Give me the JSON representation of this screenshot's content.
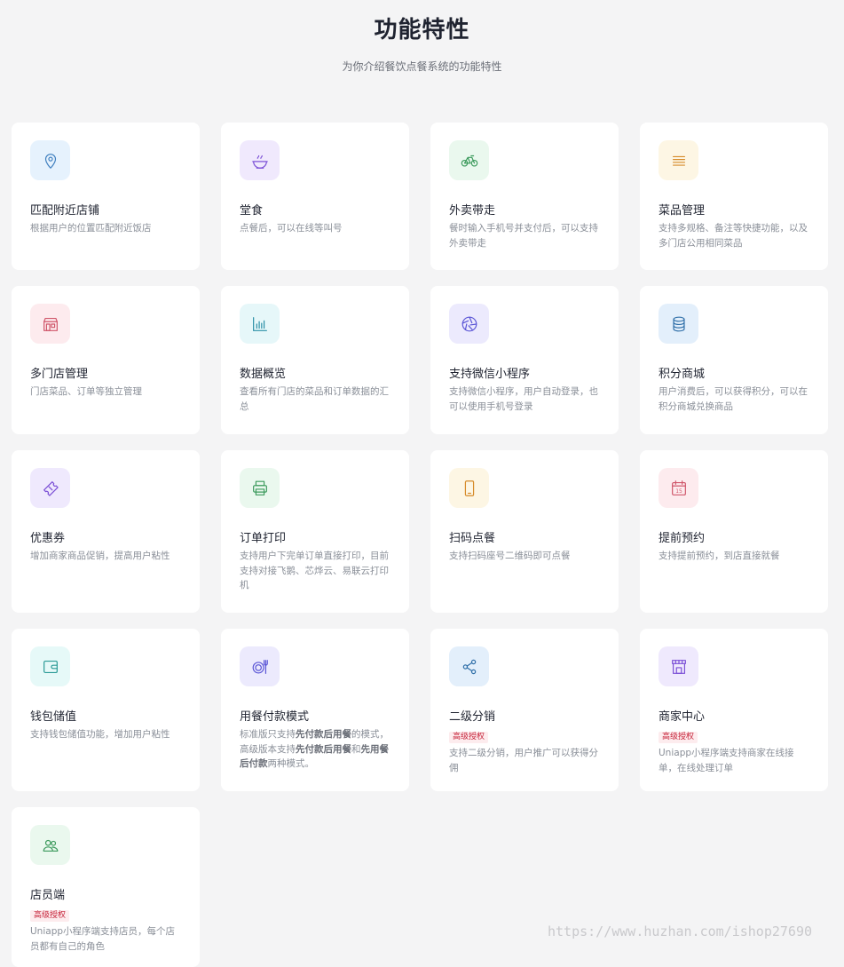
{
  "header": {
    "title": "功能特性",
    "subtitle": "为你介绍餐饮点餐系统的功能特性"
  },
  "features": [
    {
      "title": "匹配附近店铺",
      "desc": "根据用户的位置匹配附近饭店",
      "icon": "location-pin-icon",
      "icon_bg": "#e6f2fd",
      "icon_color": "#3f7fbf"
    },
    {
      "title": "堂食",
      "desc": "点餐后，可以在线等叫号",
      "icon": "food-bowl-icon",
      "icon_bg": "#f0e9fd",
      "icon_color": "#7b4fd6"
    },
    {
      "title": "外卖带走",
      "desc": "餐时输入手机号并支付后，可以支持外卖带走",
      "icon": "bicycle-icon",
      "icon_bg": "#eaf8ee",
      "icon_color": "#3c9a5c"
    },
    {
      "title": "菜品管理",
      "desc": "支持多规格、备注等快捷功能，以及多门店公用相同菜品",
      "icon": "layers-icon",
      "icon_bg": "#fdf6e4",
      "icon_color": "#d68b2a"
    },
    {
      "title": "多门店管理",
      "desc": "门店菜品、订单等独立管理",
      "icon": "storefront-icon",
      "icon_bg": "#fdebee",
      "icon_color": "#d0566a"
    },
    {
      "title": "数据概览",
      "desc": "查看所有门店的菜品和订单数据的汇总",
      "icon": "bar-chart-icon",
      "icon_bg": "#e6f7f9",
      "icon_color": "#2a8fa6"
    },
    {
      "title": "支持微信小程序",
      "desc": "支持微信小程序，用户自动登录，也可以使用手机号登录",
      "icon": "aperture-icon",
      "icon_bg": "#eceafd",
      "icon_color": "#5a55d6"
    },
    {
      "title": "积分商城",
      "desc": "用户消费后，可以获得积分，可以在积分商城兑换商品",
      "icon": "database-icon",
      "icon_bg": "#e3effb",
      "icon_color": "#2f6fa8"
    },
    {
      "title": "优惠券",
      "desc": "增加商家商品促销，提高用户粘性",
      "icon": "ticket-icon",
      "icon_bg": "#efe9fd",
      "icon_color": "#7b4fd6"
    },
    {
      "title": "订单打印",
      "desc": "支持用户下完单订单直接打印，目前支持对接飞鹅、芯烨云、易联云打印机",
      "icon": "printer-icon",
      "icon_bg": "#eaf8ee",
      "icon_color": "#3c9a5c"
    },
    {
      "title": "扫码点餐",
      "desc": "支持扫码座号二维码即可点餐",
      "icon": "phone-icon",
      "icon_bg": "#fdf6e4",
      "icon_color": "#d68b2a"
    },
    {
      "title": "提前预约",
      "desc": "支持提前预约，到店直接就餐",
      "icon": "calendar-icon",
      "icon_bg": "#fdebee",
      "icon_color": "#d0566a"
    },
    {
      "title": "钱包储值",
      "desc": "支持钱包储值功能，增加用户粘性",
      "icon": "wallet-icon",
      "icon_bg": "#e6f9f8",
      "icon_color": "#2a9a96"
    },
    {
      "title": "用餐付款模式",
      "desc_parts": [
        "标准版只支持",
        "先付款后用餐",
        "的模式，高级版本支持",
        "先付款后用餐",
        "和",
        "先用餐后付款",
        "两种模式。"
      ],
      "icon": "dining-icon",
      "icon_bg": "#eceafd",
      "icon_color": "#5a55d6"
    },
    {
      "title": "二级分销",
      "badge": "高级授权",
      "desc": "支持二级分销，用户推广可以获得分佣",
      "icon": "share-icon",
      "icon_bg": "#e3effb",
      "icon_color": "#2f6fa8"
    },
    {
      "title": "商家中心",
      "badge": "高级授权",
      "desc": "Uniapp小程序端支持商家在线接单，在线处理订单",
      "icon": "shop-icon",
      "icon_bg": "#efe9fd",
      "icon_color": "#7b4fd6"
    },
    {
      "title": "店员端",
      "badge": "高级授权",
      "desc": "Uniapp小程序端支持店员，每个店员都有自己的角色",
      "icon": "users-icon",
      "icon_bg": "#eaf8ee",
      "icon_color": "#3c9a5c"
    }
  ],
  "watermark": "https://www.huzhan.com/ishop27690"
}
